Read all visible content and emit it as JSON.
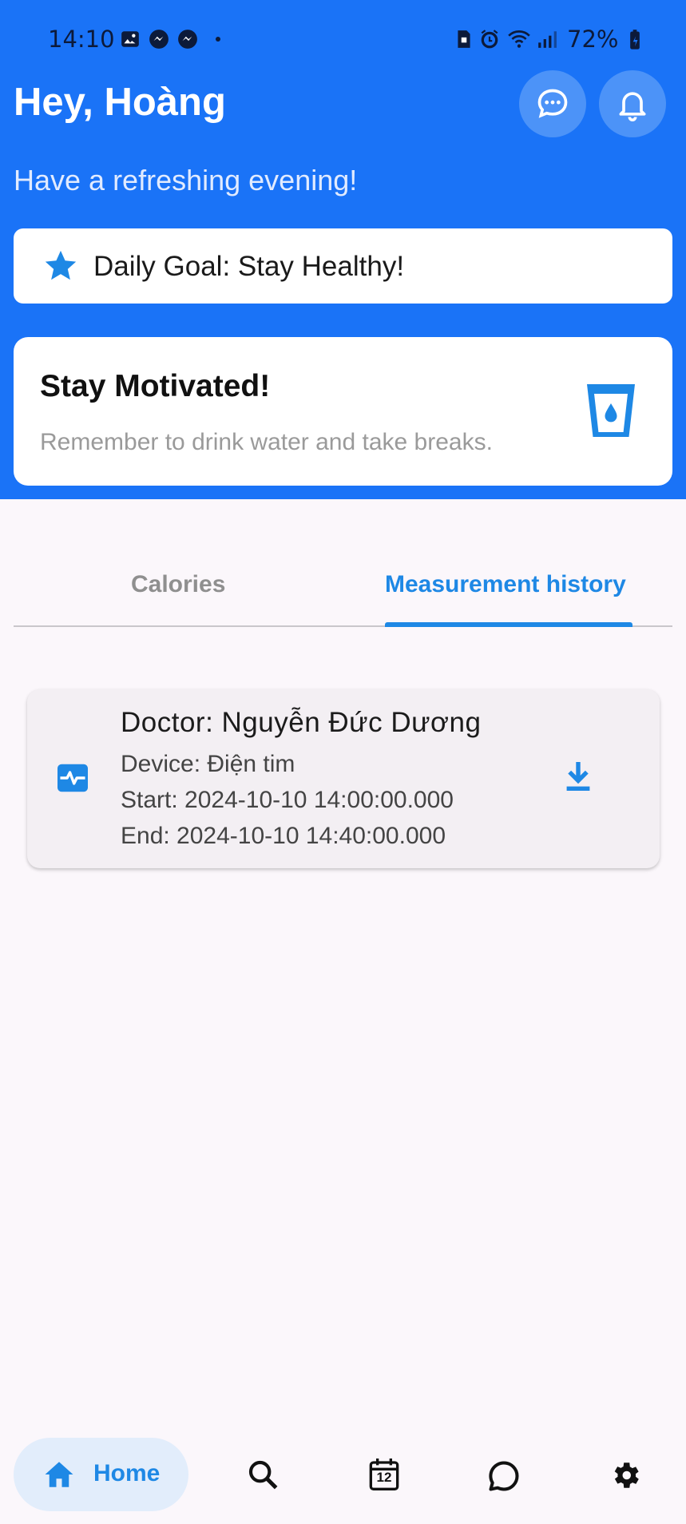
{
  "status_bar": {
    "time": "14:10",
    "battery": "72%"
  },
  "header": {
    "greeting": "Hey, Hoàng",
    "subtitle": "Have a refreshing evening!",
    "accent_color": "#1a73f7"
  },
  "goal_card": {
    "text": "Daily Goal: Stay Healthy!",
    "icon": "star-icon"
  },
  "motivation_card": {
    "title": "Stay Motivated!",
    "description": "Remember to drink water and take breaks.",
    "icon": "water-glass-icon"
  },
  "tabs": [
    {
      "label": "Calories",
      "active": false
    },
    {
      "label": "Measurement history",
      "active": true
    }
  ],
  "history": [
    {
      "doctor": "Doctor: Nguyễn Đức Dương",
      "device": "Device: Điện tim",
      "start": "Start: 2024-10-10 14:00:00.000",
      "end": "End: 2024-10-10 14:40:00.000"
    }
  ],
  "bottom_nav": {
    "items": [
      {
        "label": "Home",
        "icon": "home-icon",
        "active": true
      },
      {
        "icon": "search-icon"
      },
      {
        "icon": "calendar-icon",
        "badge": "12"
      },
      {
        "icon": "chat-icon"
      },
      {
        "icon": "settings-icon"
      }
    ]
  }
}
